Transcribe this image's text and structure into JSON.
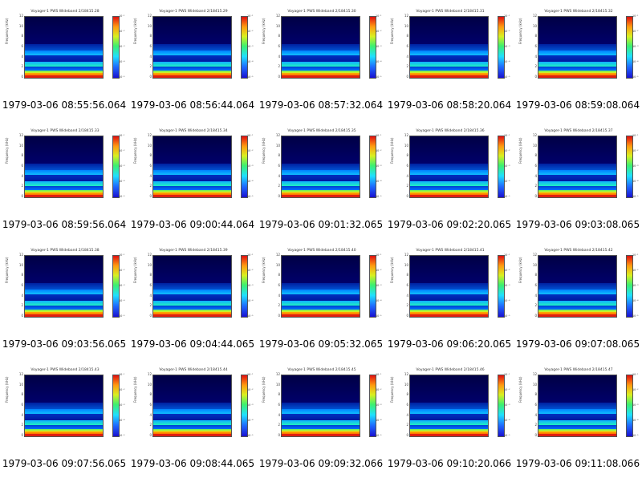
{
  "panels": [
    {
      "title": "Voyager-1 PWS Wideband 2/18415.28",
      "timestamp": "1979-03-06 08:55:56.064"
    },
    {
      "title": "Voyager-1 PWS Wideband 2/18415.29",
      "timestamp": "1979-03-06 08:56:44.064"
    },
    {
      "title": "Voyager-1 PWS Wideband 2/18415.30",
      "timestamp": "1979-03-06 08:57:32.064"
    },
    {
      "title": "Voyager-1 PWS Wideband 2/18415.31",
      "timestamp": "1979-03-06 08:58:20.064"
    },
    {
      "title": "Voyager-1 PWS Wideband 2/18415.32",
      "timestamp": "1979-03-06 08:59:08.064"
    },
    {
      "title": "Voyager-1 PWS Wideband 2/18415.33",
      "timestamp": "1979-03-06 08:59:56.064"
    },
    {
      "title": "Voyager-1 PWS Wideband 2/18415.34",
      "timestamp": "1979-03-06 09:00:44.064"
    },
    {
      "title": "Voyager-1 PWS Wideband 2/18415.35",
      "timestamp": "1979-03-06 09:01:32.065"
    },
    {
      "title": "Voyager-1 PWS Wideband 2/18415.36",
      "timestamp": "1979-03-06 09:02:20.065"
    },
    {
      "title": "Voyager-1 PWS Wideband 2/18415.37",
      "timestamp": "1979-03-06 09:03:08.065"
    },
    {
      "title": "Voyager-1 PWS Wideband 2/18415.38",
      "timestamp": "1979-03-06 09:03:56.065"
    },
    {
      "title": "Voyager-1 PWS Wideband 2/18415.39",
      "timestamp": "1979-03-06 09:04:44.065"
    },
    {
      "title": "Voyager-1 PWS Wideband 2/18415.40",
      "timestamp": "1979-03-06 09:05:32.065"
    },
    {
      "title": "Voyager-1 PWS Wideband 2/18415.41",
      "timestamp": "1979-03-06 09:06:20.065"
    },
    {
      "title": "Voyager-1 PWS Wideband 2/18415.42",
      "timestamp": "1979-03-06 09:07:08.065"
    },
    {
      "title": "Voyager-1 PWS Wideband 2/18415.43",
      "timestamp": "1979-03-06 09:07:56.065"
    },
    {
      "title": "Voyager-1 PWS Wideband 2/18415.44",
      "timestamp": "1979-03-06 09:08:44.065"
    },
    {
      "title": "Voyager-1 PWS Wideband 2/18415.45",
      "timestamp": "1979-03-06 09:09:32.066"
    },
    {
      "title": "Voyager-1 PWS Wideband 2/18415.46",
      "timestamp": "1979-03-06 09:10:20.066"
    },
    {
      "title": "Voyager-1 PWS Wideband 2/18415.47",
      "timestamp": "1979-03-06 09:11:08.066"
    }
  ],
  "axis": {
    "ylabel": "Frequency (kHz)",
    "yticks": [
      "12",
      "10",
      "8",
      "6",
      "4",
      "2",
      "0"
    ],
    "colorbar_label": "relative power spectral density",
    "colorbar_ticks": [
      "10⁻¹",
      "10⁻²",
      "10⁻³",
      "10⁻⁴",
      "10⁻⁵"
    ]
  },
  "colors": {
    "background": "#000033",
    "low": "#1a10d0",
    "mid": "#1fe0ff",
    "high": "#ff9a10",
    "max": "#e01010"
  }
}
